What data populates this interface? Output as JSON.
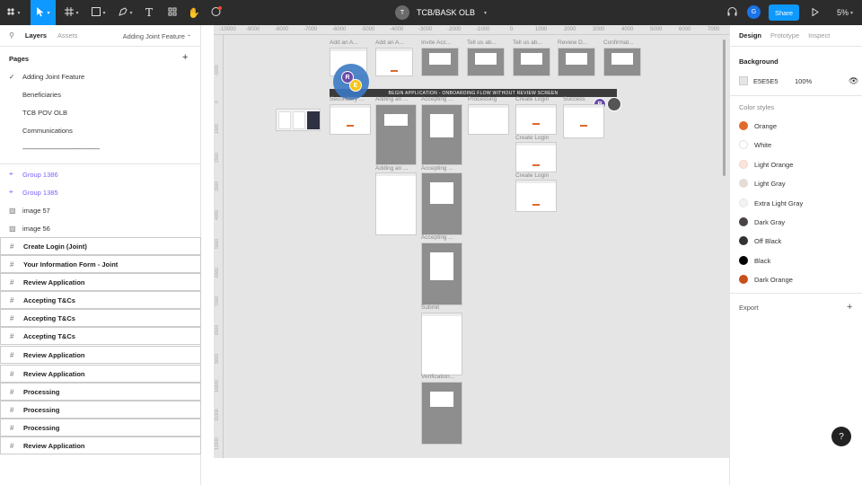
{
  "app": {
    "file_title": "TCB/BASK OLB",
    "file_owner_initial": "T",
    "user_initial": "G",
    "share_label": "Share",
    "zoom": "5%",
    "accent": "#0d99ff"
  },
  "left_panel": {
    "tabs": [
      "Layers",
      "Assets"
    ],
    "current_page": "Adding Joint Feature",
    "pages_heading": "Pages",
    "pages": [
      "Adding Joint Feature",
      "Beneficiaries",
      "TCB POV OLB",
      "Communications",
      "-------------------------------------------"
    ],
    "layers": [
      {
        "name": "Group 1386",
        "type": "group"
      },
      {
        "name": "Group 1385",
        "type": "group"
      },
      {
        "name": "image 57",
        "type": "image"
      },
      {
        "name": "image 56",
        "type": "image"
      },
      {
        "name": "Create Login (Joint)",
        "type": "frame"
      },
      {
        "name": "Your Information Form - Joint",
        "type": "frame"
      },
      {
        "name": "Review Application",
        "type": "frame"
      },
      {
        "name": "Accepting T&Cs",
        "type": "frame"
      },
      {
        "name": "Accepting T&Cs",
        "type": "frame"
      },
      {
        "name": "Accepting T&Cs",
        "type": "frame"
      },
      {
        "name": "Review Application",
        "type": "frame"
      },
      {
        "name": "Review Application",
        "type": "frame"
      },
      {
        "name": "Processing",
        "type": "frame"
      },
      {
        "name": "Processing",
        "type": "frame"
      },
      {
        "name": "Processing",
        "type": "frame"
      },
      {
        "name": "Review Application",
        "type": "frame"
      }
    ]
  },
  "canvas": {
    "ruler_top": [
      "-10000",
      "-9000",
      "-8000",
      "-7000",
      "-6000",
      "-5000",
      "-4000",
      "-3000",
      "-2000",
      "-1000",
      "0",
      "1000",
      "2000",
      "3000",
      "4000",
      "5000",
      "6000",
      "7000"
    ],
    "ruler_left": [
      "-1000",
      "0",
      "1000",
      "2000",
      "3000",
      "4000",
      "5000",
      "6000",
      "7000",
      "8000",
      "9000",
      "10000",
      "11000",
      "12000"
    ],
    "banner": "BEGIN APPLICATION - ONBOARDING FLOW WITHOUT REVIEW SCREEN",
    "frame_labels": [
      "Add an A...",
      "Add an A...",
      "Invite Acc...",
      "Tell us ab...",
      "Tell us ab...",
      "Review D...",
      "Confirmat...",
      "Secondary ...",
      "Adding an ...",
      "Accepting ...",
      "Processing",
      "Create Login",
      "Success",
      "Create Login",
      "Create Login",
      "Adding an ...",
      "Accepting ...",
      "Accepting ...",
      "Submit",
      "Verification..."
    ],
    "cursors": [
      {
        "initial": "R",
        "color": "#6b4ba8"
      },
      {
        "initial": "E",
        "color": "#f5c518"
      },
      {
        "initial": "R",
        "color": "#6b4ba8"
      }
    ]
  },
  "right_panel": {
    "tabs": [
      "Design",
      "Prototype",
      "Inspect"
    ],
    "background_heading": "Background",
    "background_hex": "E5E5E5",
    "background_opacity": "100%",
    "color_styles_heading": "Color styles",
    "color_styles": [
      {
        "name": "Orange",
        "color": "#e06a2b"
      },
      {
        "name": "White",
        "color": "#ffffff"
      },
      {
        "name": "Light Orange",
        "color": "#fbe5da"
      },
      {
        "name": "Light Gray",
        "color": "#e6dcd6"
      },
      {
        "name": "Extra Light Gray",
        "color": "#f3f3f3"
      },
      {
        "name": "Dark Gray",
        "color": "#4a4346"
      },
      {
        "name": "Off Black",
        "color": "#333333"
      },
      {
        "name": "Black",
        "color": "#000000"
      },
      {
        "name": "Dark Orange",
        "color": "#c94f18"
      }
    ],
    "export_heading": "Export"
  },
  "help_label": "?"
}
